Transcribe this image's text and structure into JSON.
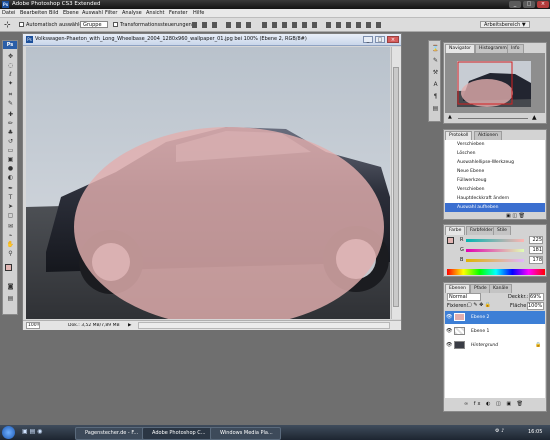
{
  "app": {
    "title": "Adobe Photoshop CS3 Extended",
    "icon": "ps-icon"
  },
  "window_controls": [
    "_",
    "□",
    "×"
  ],
  "menu": [
    "Datei",
    "Bearbeiten",
    "Bild",
    "Ebene",
    "Auswahl",
    "Filter",
    "Analyse",
    "Ansicht",
    "Fenster",
    "Hilfe"
  ],
  "options_bar": {
    "auto_select_label": "Automatisch auswählen:",
    "auto_select_value": "Gruppe",
    "transform_label": "Transformationssteuerungen",
    "workspace_label": "Arbeitsbereich ▼"
  },
  "document": {
    "title": "Volkswagen-Phaeton_with_Long_Wheelbase_2004_1280x960_wallpaper_01.jpg bei 100% (Ebene 2, RGB/8#)",
    "zoom": "100%",
    "doc_size": "Dok.: 3,52 MB/7,89 MB"
  },
  "navigator": {
    "tabs": [
      "Navigator",
      "Histogramm",
      "Info"
    ]
  },
  "history": {
    "tabs": [
      "Protokoll",
      "Aktionen"
    ],
    "items": [
      "Verschieben",
      "Löschen",
      "Auswahlellipse-Werkzeug",
      "Neue Ebene",
      "Füllwerkzeug",
      "Verschieben",
      "Hauptdeckkraft ändern",
      "Auswahl aufheben"
    ]
  },
  "color": {
    "tabs": [
      "Farbe",
      "Farbfelder",
      "Stile"
    ],
    "channels": [
      {
        "label": "R",
        "value": "225"
      },
      {
        "label": "G",
        "value": "181"
      },
      {
        "label": "B",
        "value": "178"
      }
    ],
    "foreground_hex": "#e1b5b2"
  },
  "layers": {
    "tabs": [
      "Ebenen",
      "Pfade",
      "Kanäle"
    ],
    "blend_mode": "Normal",
    "opacity_label": "Deckkr.:",
    "opacity_value": "69%",
    "fill_label": "Fläche:",
    "fill_value": "100%",
    "lock_label": "Fixieren:",
    "items": [
      "Ebene 2",
      "Ebene 1",
      "Hintergrund"
    ]
  },
  "taskbar": {
    "items": [
      "Pagenstecher.de - F...",
      "Adobe Photoshop C...",
      "Windows Media Pla..."
    ],
    "time": "16:05"
  },
  "colors": {
    "accent": "#3d7fd6",
    "selection_fill": "#e2aeae",
    "history_active": "#3b6fd0"
  }
}
